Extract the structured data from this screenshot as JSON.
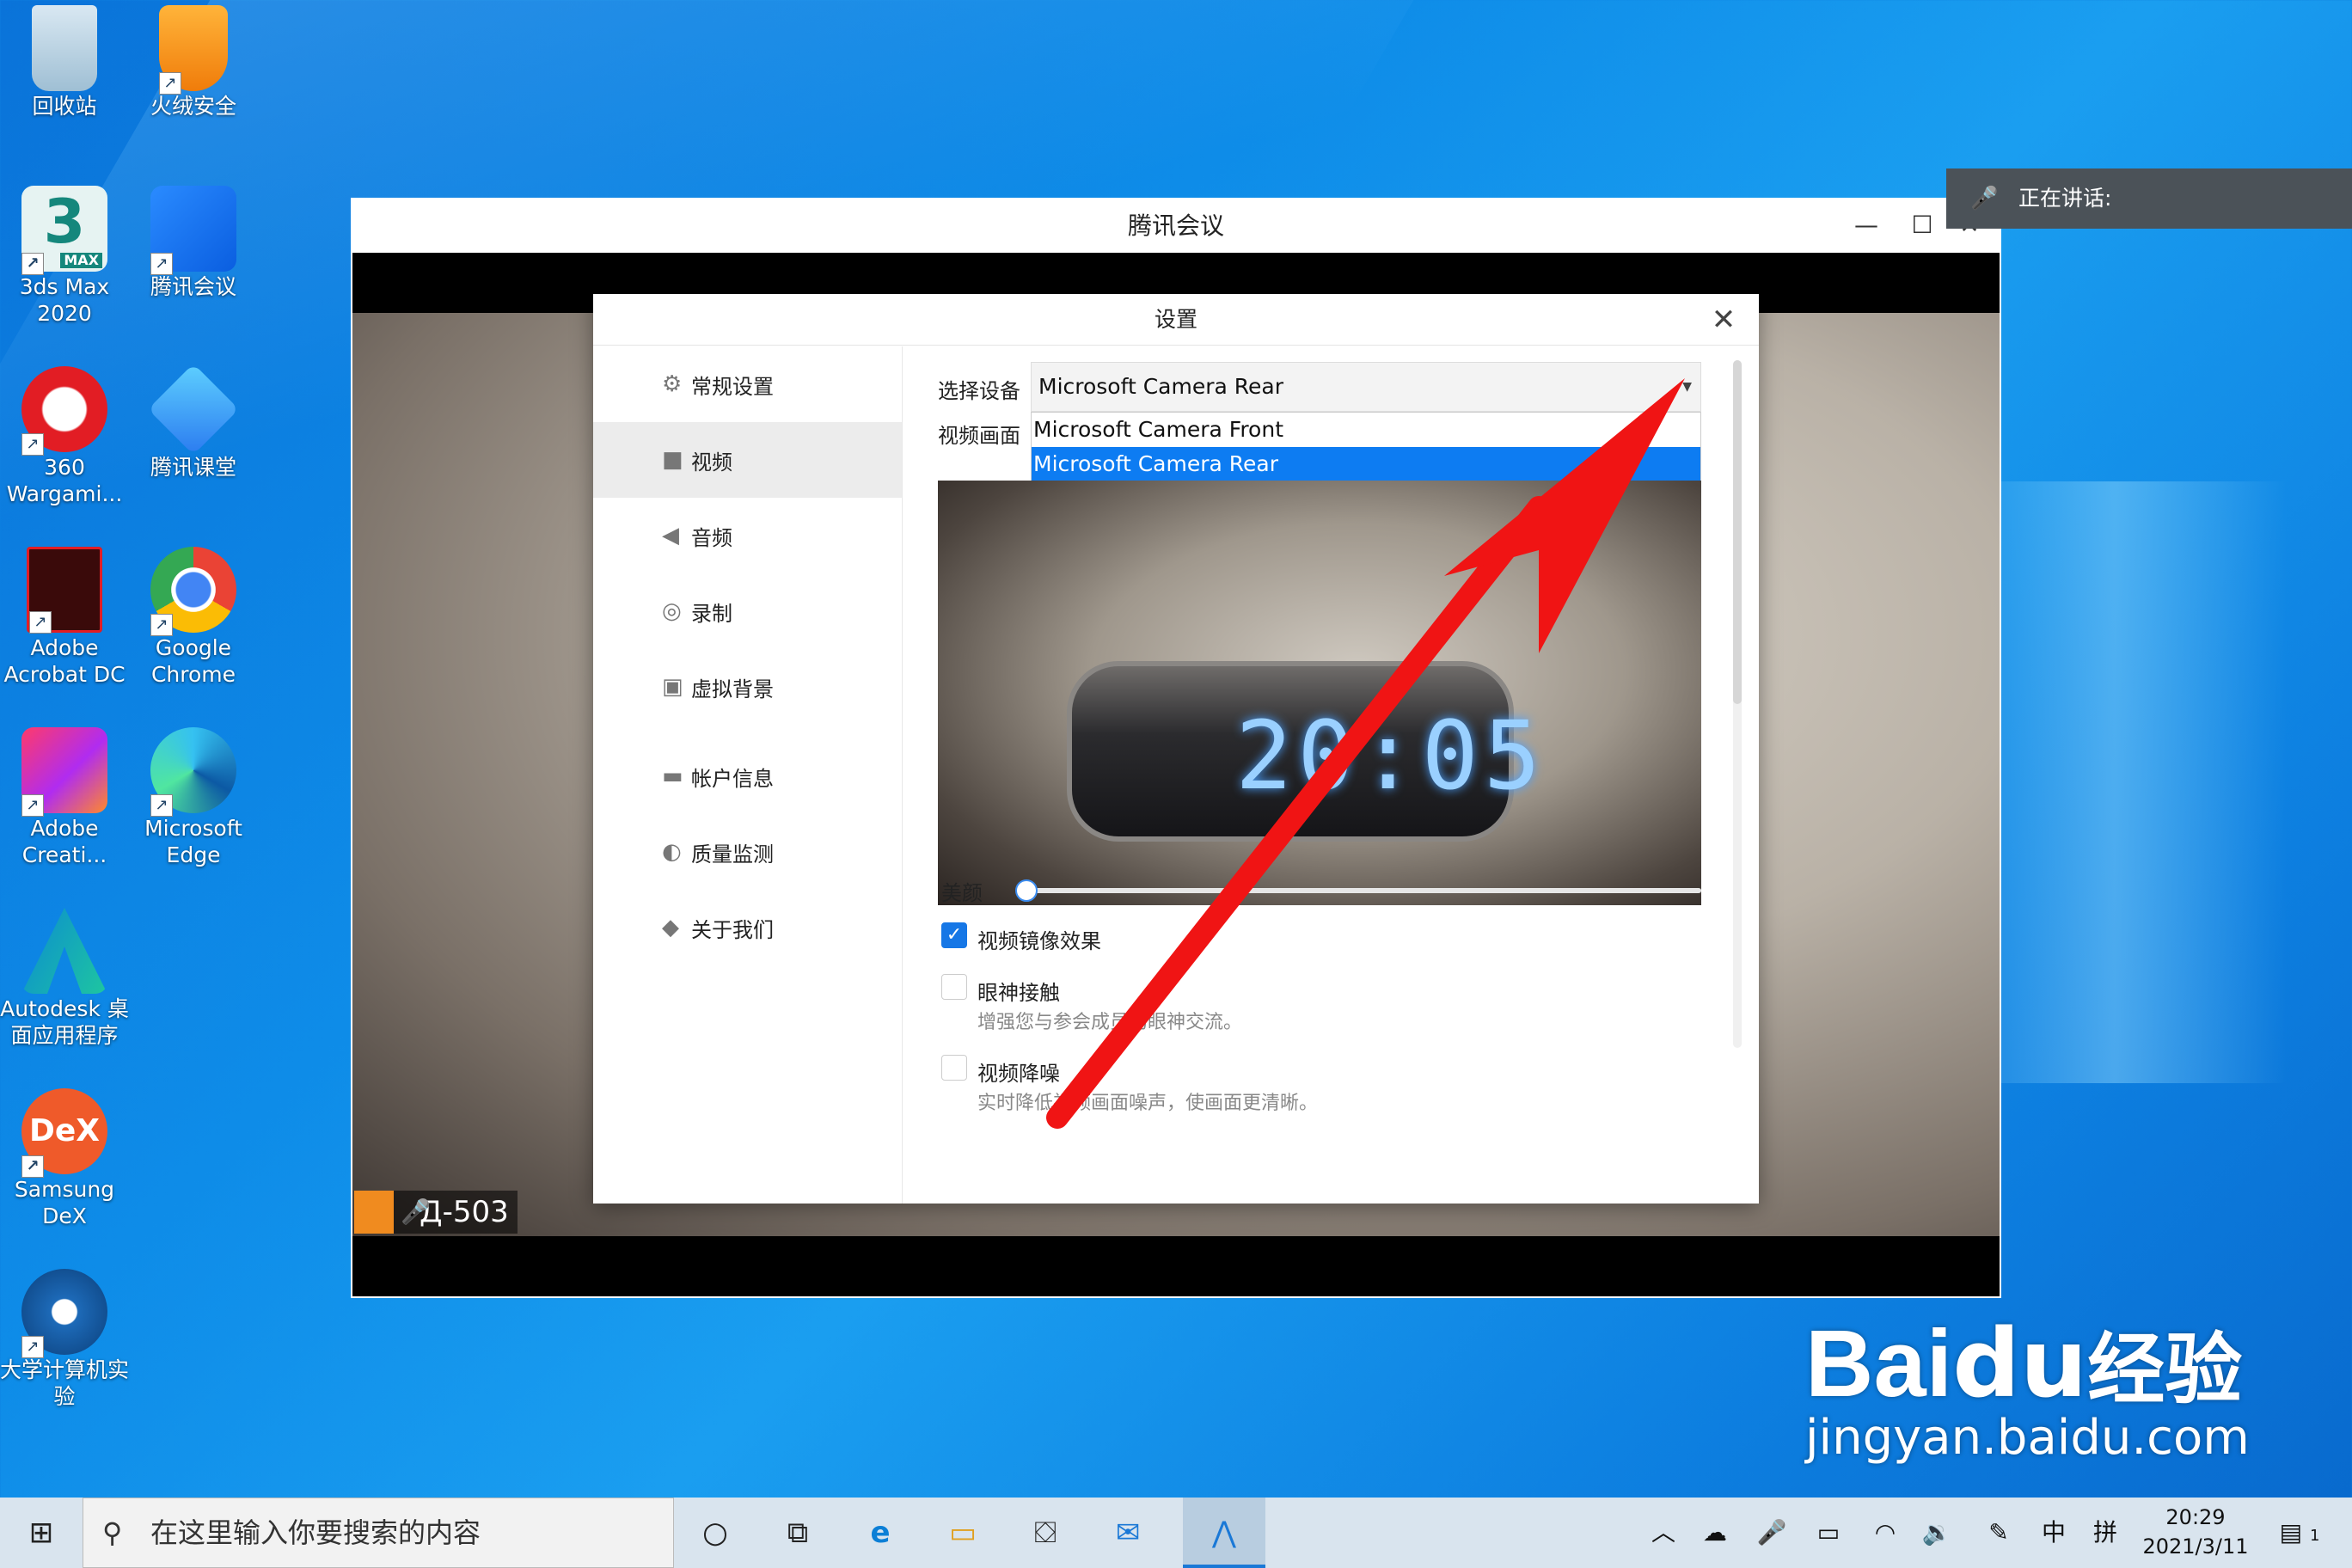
{
  "desktop": {
    "icons": [
      {
        "label": "回收站",
        "name": "recycle-bin-icon"
      },
      {
        "label": "火绒安全",
        "name": "huorong-icon"
      },
      {
        "label": "3ds Max 2020",
        "name": "3ds-max-icon"
      },
      {
        "label": "腾讯会议",
        "name": "tencent-meeting-icon"
      },
      {
        "label": "360 Wargami...",
        "name": "360-icon"
      },
      {
        "label": "腾讯课堂",
        "name": "tencent-classroom-icon"
      },
      {
        "label": "Adobe Acrobat DC",
        "name": "acrobat-icon"
      },
      {
        "label": "Google Chrome",
        "name": "chrome-icon"
      },
      {
        "label": "Adobe Creati...",
        "name": "creative-cloud-icon"
      },
      {
        "label": "Microsoft Edge",
        "name": "edge-icon"
      },
      {
        "label": "Autodesk 桌面应用程序",
        "name": "autodesk-icon"
      },
      {
        "label": "Samsung DeX",
        "name": "samsung-dex-icon"
      },
      {
        "label": "大学计算机实验",
        "name": "university-lab-icon"
      }
    ],
    "dex_badge": "DeX",
    "max_badge": "MAX",
    "max_number": "3"
  },
  "meeting_window": {
    "title": "腾讯会议",
    "minimize": "—",
    "maximize": "☐",
    "close": "✕",
    "participant": "Д-503"
  },
  "speaking": {
    "label": "正在讲话:"
  },
  "settings": {
    "title": "设置",
    "close": "✕",
    "nav": [
      {
        "icon": "⚙",
        "label": "常规设置"
      },
      {
        "icon": "■",
        "label": "视频"
      },
      {
        "icon": "◀",
        "label": "音频"
      },
      {
        "icon": "◎",
        "label": "录制"
      },
      {
        "icon": "▣",
        "label": "虚拟背景"
      },
      {
        "icon": "▬",
        "label": "帐户信息"
      },
      {
        "icon": "◐",
        "label": "质量监测"
      },
      {
        "icon": "◆",
        "label": "关于我们"
      }
    ],
    "device_label": "选择设备",
    "device_value": "Microsoft Camera Rear",
    "device_options": [
      "Microsoft Camera Front",
      "Microsoft Camera Rear"
    ],
    "selected_option": "Microsoft Camera Rear",
    "preview_label": "视频画面",
    "clock_digits": "20:05",
    "beauty_label": "美颜",
    "beauty_value": 0,
    "mirror_label": "视频镜像效果",
    "mirror_checked": true,
    "eye_label": "眼神接触",
    "eye_checked": false,
    "eye_desc": "增强您与参会成员的眼神交流。",
    "denoise_label": "视频降噪",
    "denoise_checked": false,
    "denoise_desc": "实时降低视频画面噪声，使画面更清晰。"
  },
  "taskbar": {
    "start": "⊞",
    "search_placeholder": "在这里输入你要搜索的内容",
    "apps": [
      "○",
      "⧉",
      "e",
      "▭",
      "⛋",
      "✉",
      "⋀"
    ],
    "tray": [
      "︿",
      "☁",
      "🎤",
      "▭",
      "◠",
      "🔉",
      "✎",
      "中",
      "拼"
    ],
    "time": "20:29",
    "date": "2021/3/11",
    "notify": "1"
  },
  "watermark": {
    "brand": "Bai",
    "paw": "du",
    "cn": "经验",
    "url": "jingyan.baidu.com"
  },
  "colors": {
    "accent": "#0d7cf2",
    "arrow": "#f01414"
  }
}
